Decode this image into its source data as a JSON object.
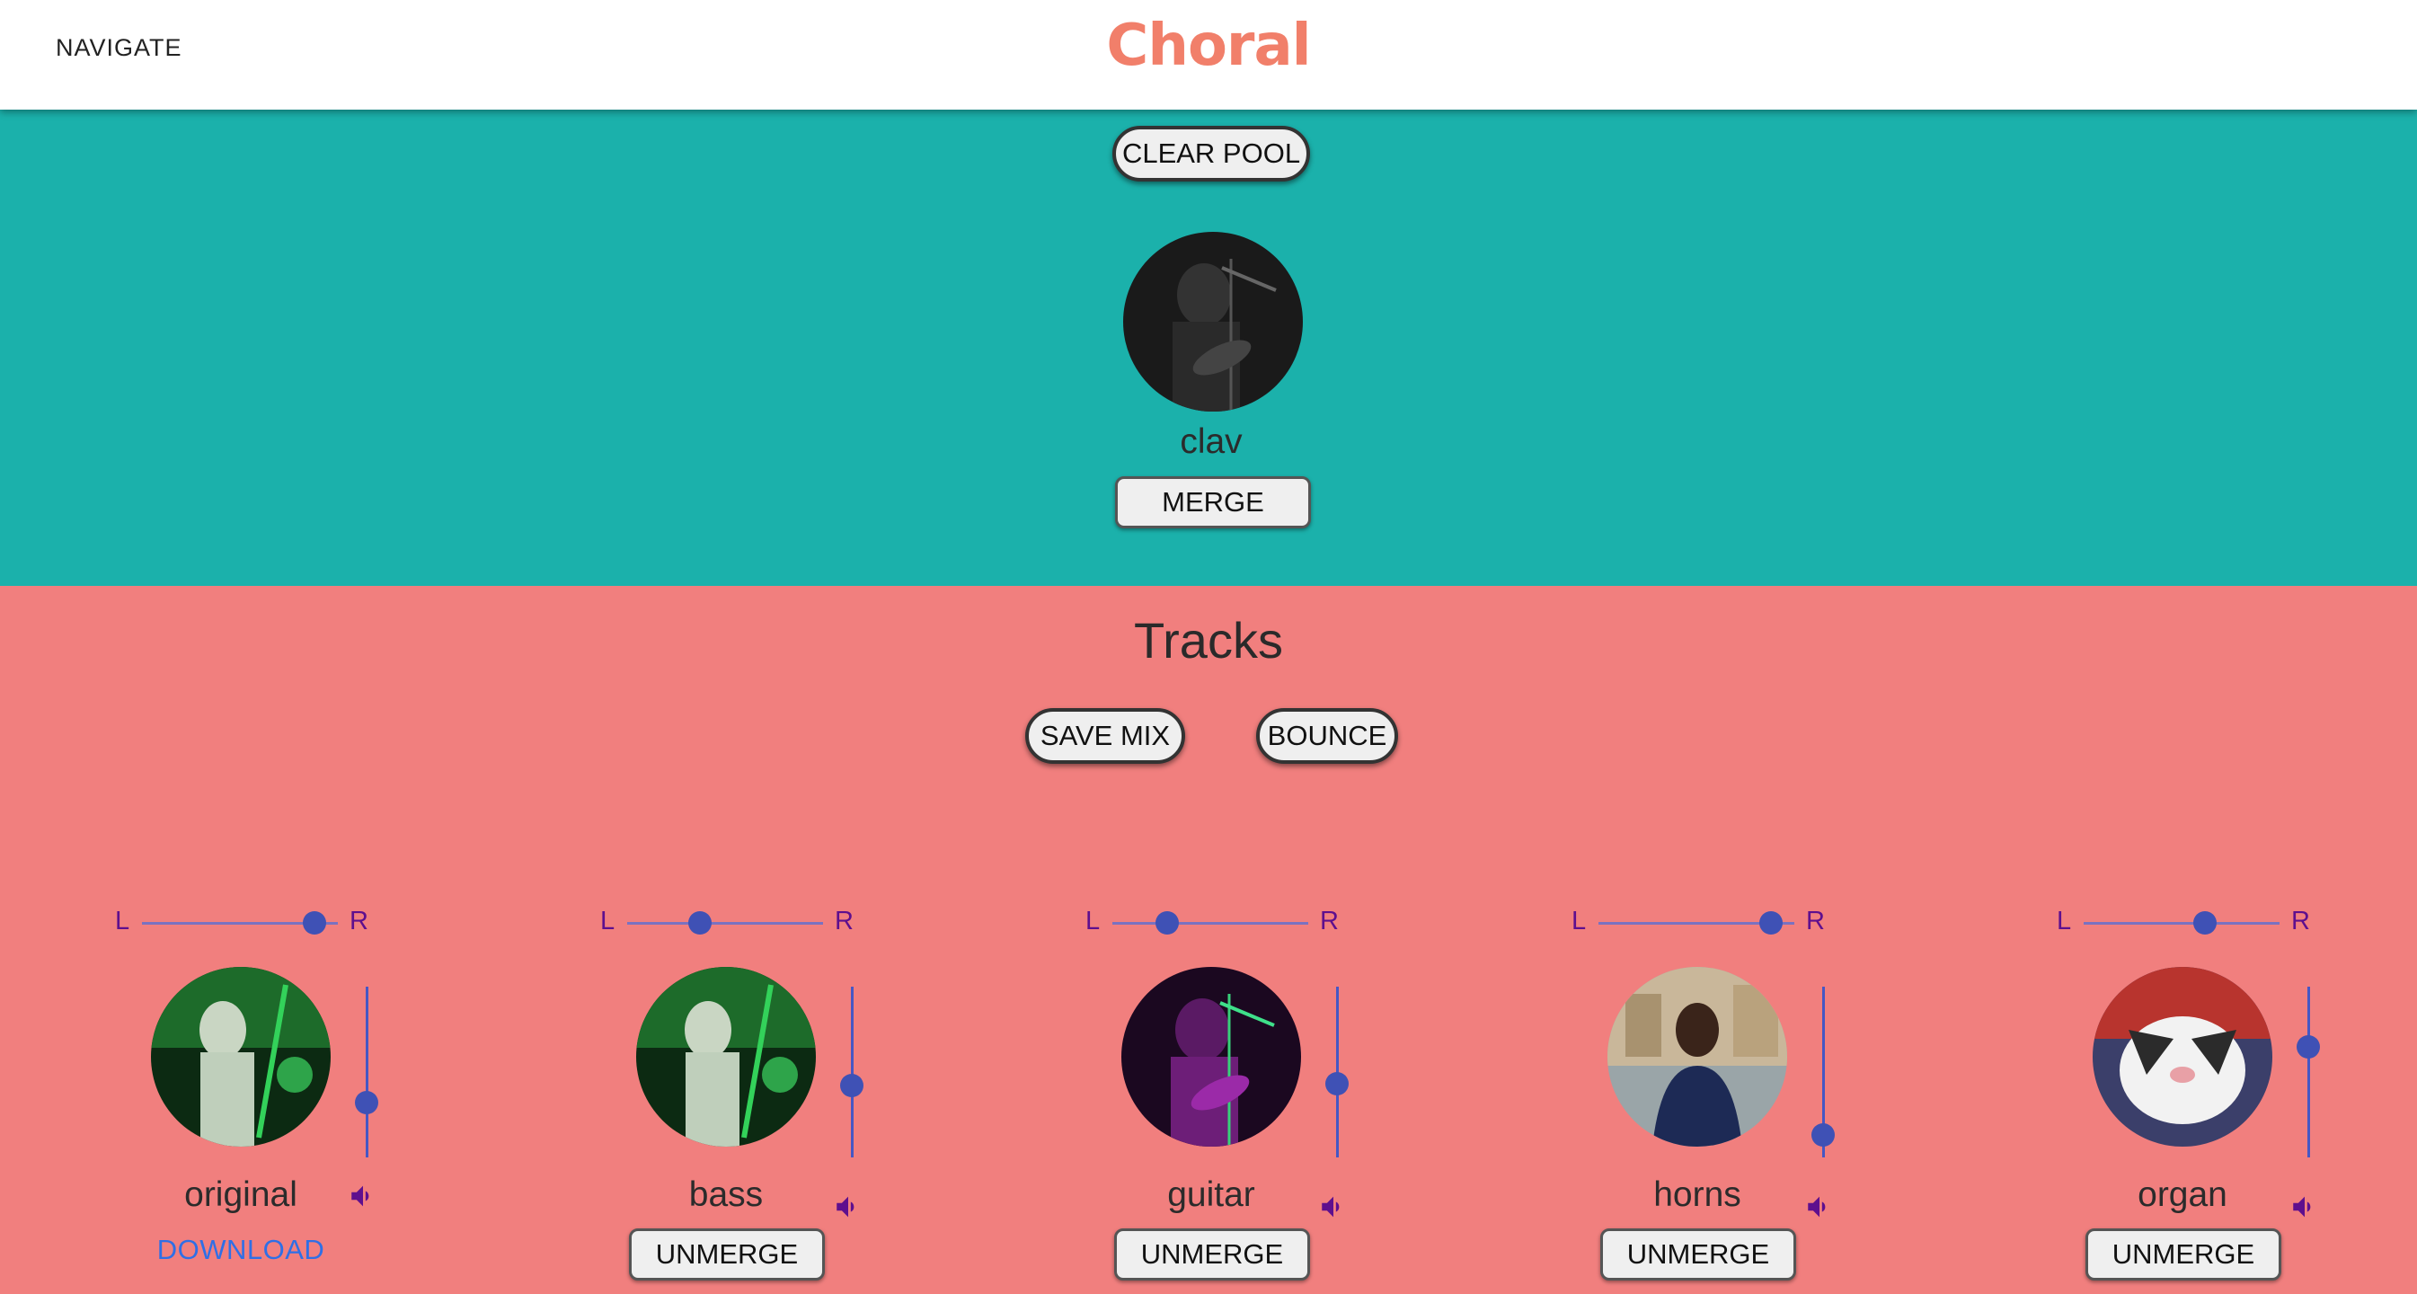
{
  "header": {
    "nav_label": "NAVIGATE",
    "brand": "Choral"
  },
  "pool": {
    "clear_label": "CLEAR POOL",
    "item": {
      "name": "clav",
      "merge_label": "MERGE"
    }
  },
  "tracks": {
    "title": "Tracks",
    "save_label": "SAVE MIX",
    "bounce_label": "BOUNCE",
    "pan_left": "L",
    "pan_right": "R",
    "download_label": "DOWNLOAD",
    "unmerge_label": "UNMERGE",
    "items": [
      {
        "name": "original",
        "pan": 0.88,
        "volume": 0.32
      },
      {
        "name": "bass",
        "pan": 0.37,
        "volume": 0.42
      },
      {
        "name": "guitar",
        "pan": 0.28,
        "volume": 0.43
      },
      {
        "name": "horns",
        "pan": 0.88,
        "volume": 0.13
      },
      {
        "name": "organ",
        "pan": 0.62,
        "volume": 0.65
      }
    ]
  },
  "colors": {
    "pool_bg": "#1bb1ab",
    "tracks_bg": "#f17f7e",
    "brand": "#f17f6a",
    "slider": "#3f51b5",
    "pan_label": "#5e0f8e",
    "download": "#2f6fe6"
  }
}
